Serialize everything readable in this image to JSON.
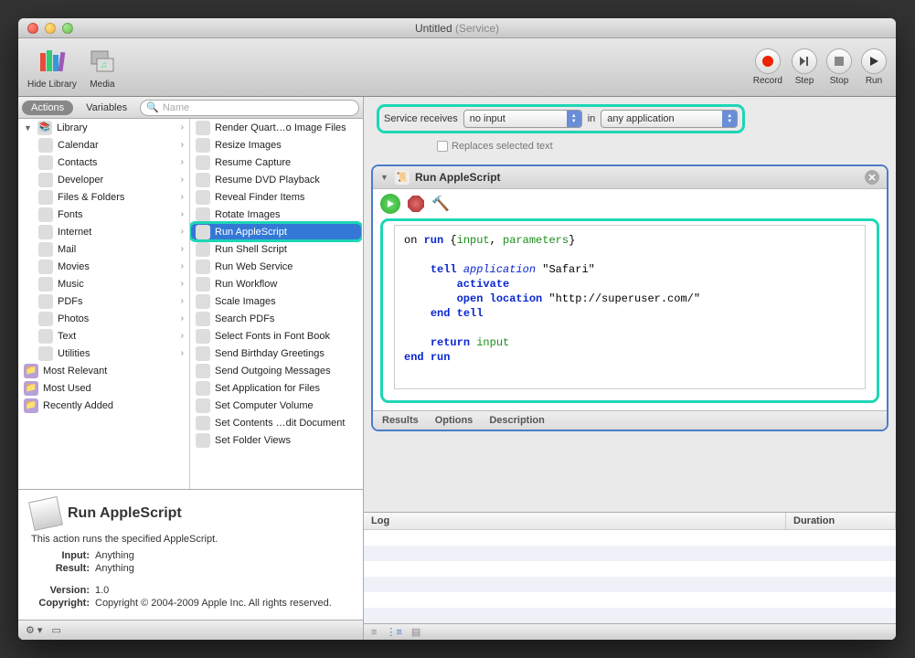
{
  "title": {
    "name": "Untitled",
    "mod": "(Service)"
  },
  "toolbar": {
    "hide_library": "Hide Library",
    "media": "Media",
    "record": "Record",
    "step": "Step",
    "stop": "Stop",
    "run": "Run"
  },
  "tabs": {
    "actions": "Actions",
    "variables": "Variables"
  },
  "search_placeholder": "Name",
  "library": {
    "root": "Library",
    "items": [
      "Calendar",
      "Contacts",
      "Developer",
      "Files & Folders",
      "Fonts",
      "Internet",
      "Mail",
      "Movies",
      "Music",
      "PDFs",
      "Photos",
      "Text",
      "Utilities"
    ],
    "smart": [
      "Most Relevant",
      "Most Used",
      "Recently Added"
    ]
  },
  "actions_list": [
    "Render Quart…o Image Files",
    "Resize Images",
    "Resume Capture",
    "Resume DVD Playback",
    "Reveal Finder Items",
    "Rotate Images",
    "Run AppleScript",
    "Run Shell Script",
    "Run Web Service",
    "Run Workflow",
    "Scale Images",
    "Search PDFs",
    "Select Fonts in Font Book",
    "Send Birthday Greetings",
    "Send Outgoing Messages",
    "Set Application for Files",
    "Set Computer Volume",
    "Set Contents …dit Document",
    "Set Folder Views"
  ],
  "selected_action_index": 6,
  "info": {
    "title": "Run AppleScript",
    "desc": "This action runs the specified AppleScript.",
    "input_lbl": "Input:",
    "input_val": "Anything",
    "result_lbl": "Result:",
    "result_val": "Anything",
    "version_lbl": "Version:",
    "version_val": "1.0",
    "copyright_lbl": "Copyright:",
    "copyright_val": "Copyright © 2004-2009 Apple Inc.  All rights reserved."
  },
  "service": {
    "label_receives": "Service receives",
    "input_value": "no input",
    "label_in": "in",
    "app_value": "any application",
    "replaces": "Replaces selected text"
  },
  "action_box": {
    "title": "Run AppleScript",
    "footer": {
      "results": "Results",
      "options": "Options",
      "description": "Description"
    }
  },
  "script": {
    "l1a": "on ",
    "l1b": "run",
    "l1c": " {",
    "l1d": "input",
    "l1e": ", ",
    "l1f": "parameters",
    "l1g": "}",
    "l2a": "tell ",
    "l2b": "application",
    "l2c": " \"Safari\"",
    "l3": "activate",
    "l4a": "open location",
    "l4b": " \"http://superuser.com/\"",
    "l5a": "end ",
    "l5b": "tell",
    "l6a": "return ",
    "l6b": "input",
    "l7a": "end ",
    "l7b": "run"
  },
  "log": {
    "col_log": "Log",
    "col_duration": "Duration"
  }
}
